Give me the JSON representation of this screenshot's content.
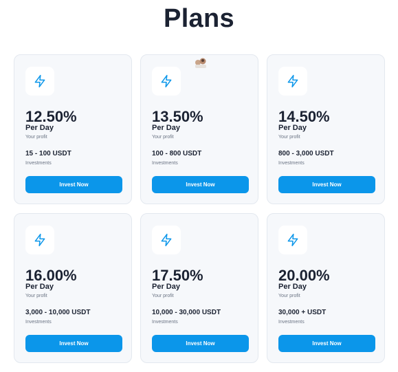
{
  "header": {
    "title": "Plans"
  },
  "colors": {
    "accent": "#0b96ea",
    "card_bg": "#f6f8fb",
    "text": "#1b2232"
  },
  "plans": [
    {
      "rate": "12.50%",
      "period": "Per Day",
      "profit_label": "Your profit",
      "range": "15 - 100 USDT",
      "investments_label": "Investments",
      "button": "Invest Now",
      "icon": "lightning-icon"
    },
    {
      "rate": "13.50%",
      "period": "Per Day",
      "profit_label": "Your profit",
      "range": "100 - 800 USDT",
      "investments_label": "Investments",
      "button": "Invest Now",
      "icon": "lightning-icon"
    },
    {
      "rate": "14.50%",
      "period": "Per Day",
      "profit_label": "Your profit",
      "range": "800 - 3,000 USDT",
      "investments_label": "Investments",
      "button": "Invest Now",
      "icon": "lightning-icon"
    },
    {
      "rate": "16.00%",
      "period": "Per Day",
      "profit_label": "Your profit",
      "range": "3,000 - 10,000 USDT",
      "investments_label": "Investments",
      "button": "Invest Now",
      "icon": "lightning-icon"
    },
    {
      "rate": "17.50%",
      "period": "Per Day",
      "profit_label": "Your profit",
      "range": "10,000 - 30,000 USDT",
      "investments_label": "Investments",
      "button": "Invest Now",
      "icon": "lightning-icon"
    },
    {
      "rate": "20.00%",
      "period": "Per Day",
      "profit_label": "Your profit",
      "range": "30,000 + USDT",
      "investments_label": "Investments",
      "button": "Invest Now",
      "icon": "lightning-icon"
    }
  ]
}
